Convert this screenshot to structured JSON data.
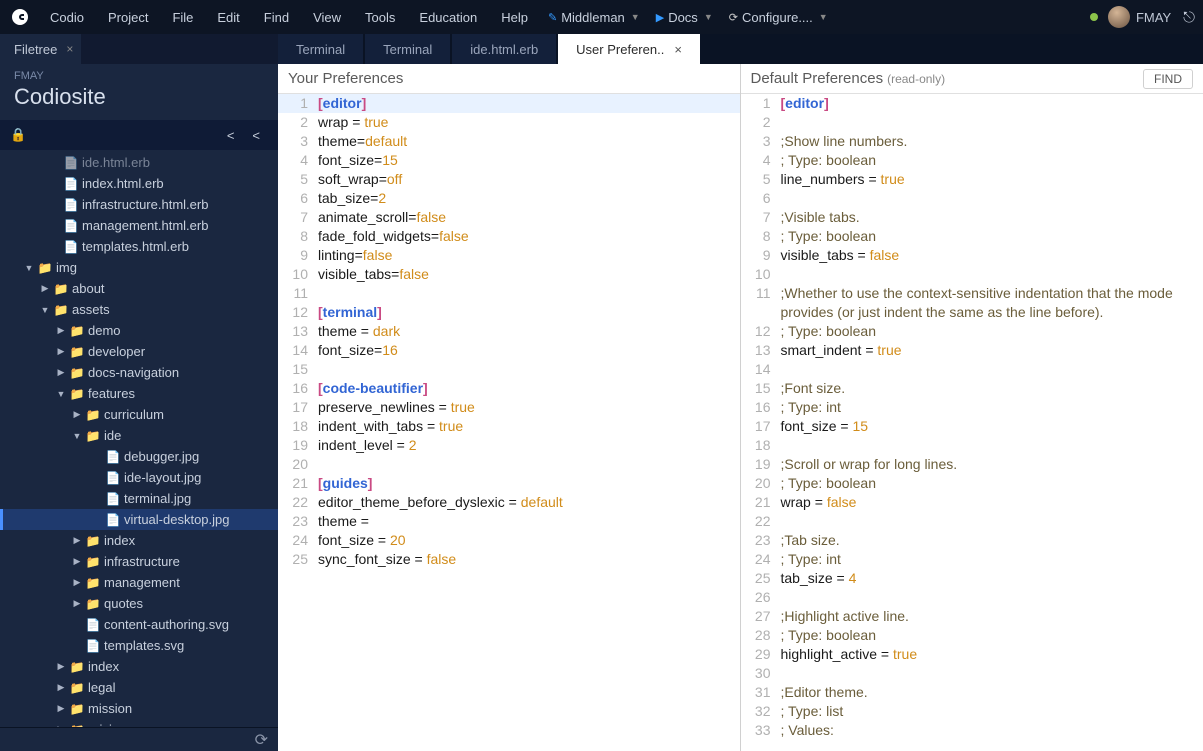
{
  "menubar": [
    "Codio",
    "Project",
    "File",
    "Edit",
    "Find",
    "View",
    "Tools",
    "Education",
    "Help"
  ],
  "configs": [
    {
      "icon": "✎",
      "label": "Middleman",
      "color": "#3399ff",
      "caret": true
    },
    {
      "icon": "▶",
      "label": "Docs",
      "color": "#3399ff",
      "caret": true
    },
    {
      "icon": "⟳",
      "label": "Configure....",
      "color": "#cccccc",
      "caret": true
    }
  ],
  "user": "FMAY",
  "sidepanel": {
    "tab": "Filetree",
    "org": "FMAY",
    "project": "Codiosite"
  },
  "tree": [
    {
      "d": 48,
      "t": "f",
      "n": "ide.html.erb",
      "dim": true
    },
    {
      "d": 48,
      "t": "f",
      "n": "index.html.erb"
    },
    {
      "d": 48,
      "t": "f",
      "n": "infrastructure.html.erb"
    },
    {
      "d": 48,
      "t": "f",
      "n": "management.html.erb"
    },
    {
      "d": 48,
      "t": "f",
      "n": "templates.html.erb"
    },
    {
      "d": 22,
      "t": "d",
      "n": "img",
      "open": true
    },
    {
      "d": 38,
      "t": "d",
      "n": "about",
      "closed": true
    },
    {
      "d": 38,
      "t": "d",
      "n": "assets",
      "open": true
    },
    {
      "d": 54,
      "t": "d",
      "n": "demo",
      "closed": true
    },
    {
      "d": 54,
      "t": "d",
      "n": "developer",
      "closed": true
    },
    {
      "d": 54,
      "t": "d",
      "n": "docs-navigation",
      "closed": true
    },
    {
      "d": 54,
      "t": "d",
      "n": "features",
      "open": true
    },
    {
      "d": 70,
      "t": "d",
      "n": "curriculum",
      "closed": true
    },
    {
      "d": 70,
      "t": "d",
      "n": "ide",
      "open": true
    },
    {
      "d": 90,
      "t": "f",
      "n": "debugger.jpg"
    },
    {
      "d": 90,
      "t": "f",
      "n": "ide-layout.jpg"
    },
    {
      "d": 90,
      "t": "f",
      "n": "terminal.jpg"
    },
    {
      "d": 90,
      "t": "f",
      "n": "virtual-desktop.jpg",
      "sel": true
    },
    {
      "d": 70,
      "t": "d",
      "n": "index",
      "closed": true
    },
    {
      "d": 70,
      "t": "d",
      "n": "infrastructure",
      "closed": true
    },
    {
      "d": 70,
      "t": "d",
      "n": "management",
      "closed": true
    },
    {
      "d": 70,
      "t": "d",
      "n": "quotes",
      "closed": true
    },
    {
      "d": 70,
      "t": "f",
      "n": "content-authoring.svg"
    },
    {
      "d": 70,
      "t": "f",
      "n": "templates.svg"
    },
    {
      "d": 54,
      "t": "d",
      "n": "index",
      "closed": true
    },
    {
      "d": 54,
      "t": "d",
      "n": "legal",
      "closed": true
    },
    {
      "d": 54,
      "t": "d",
      "n": "mission",
      "closed": true
    },
    {
      "d": 54,
      "t": "d",
      "n": "pricing",
      "closed": true
    }
  ],
  "tabs": [
    {
      "label": "Terminal"
    },
    {
      "label": "Terminal"
    },
    {
      "label": "ide.html.erb"
    },
    {
      "label": "User Preferen..",
      "active": true,
      "close": true
    }
  ],
  "left": {
    "title": "Your Preferences",
    "lines": [
      [
        {
          "c": "br",
          "t": "["
        },
        {
          "c": "sec",
          "t": "editor"
        },
        {
          "c": "br",
          "t": "]"
        }
      ],
      [
        {
          "c": "key",
          "t": "wrap"
        },
        {
          "c": "op",
          "t": " = "
        },
        {
          "c": "val",
          "t": "true"
        }
      ],
      [
        {
          "c": "key",
          "t": "theme"
        },
        {
          "c": "op",
          "t": "="
        },
        {
          "c": "val",
          "t": "default"
        }
      ],
      [
        {
          "c": "key",
          "t": "font_size"
        },
        {
          "c": "op",
          "t": "="
        },
        {
          "c": "val",
          "t": "15"
        }
      ],
      [
        {
          "c": "key",
          "t": "soft_wrap"
        },
        {
          "c": "op",
          "t": "="
        },
        {
          "c": "val",
          "t": "off"
        }
      ],
      [
        {
          "c": "key",
          "t": "tab_size"
        },
        {
          "c": "op",
          "t": "="
        },
        {
          "c": "val",
          "t": "2"
        }
      ],
      [
        {
          "c": "key",
          "t": "animate_scroll"
        },
        {
          "c": "op",
          "t": "="
        },
        {
          "c": "val",
          "t": "false"
        }
      ],
      [
        {
          "c": "key",
          "t": "fade_fold_widgets"
        },
        {
          "c": "op",
          "t": "="
        },
        {
          "c": "val",
          "t": "false"
        }
      ],
      [
        {
          "c": "key",
          "t": "linting"
        },
        {
          "c": "op",
          "t": "="
        },
        {
          "c": "val",
          "t": "false"
        }
      ],
      [
        {
          "c": "key",
          "t": "visible_tabs"
        },
        {
          "c": "op",
          "t": "="
        },
        {
          "c": "val",
          "t": "false"
        }
      ],
      [],
      [
        {
          "c": "br",
          "t": "["
        },
        {
          "c": "sec",
          "t": "terminal"
        },
        {
          "c": "br",
          "t": "]"
        }
      ],
      [
        {
          "c": "key",
          "t": "theme"
        },
        {
          "c": "op",
          "t": " = "
        },
        {
          "c": "val",
          "t": "dark"
        }
      ],
      [
        {
          "c": "key",
          "t": "font_size"
        },
        {
          "c": "op",
          "t": "="
        },
        {
          "c": "val",
          "t": "16"
        }
      ],
      [],
      [
        {
          "c": "br",
          "t": "["
        },
        {
          "c": "sec",
          "t": "code-beautifier"
        },
        {
          "c": "br",
          "t": "]"
        }
      ],
      [
        {
          "c": "key",
          "t": "preserve_newlines"
        },
        {
          "c": "op",
          "t": " = "
        },
        {
          "c": "val",
          "t": "true"
        }
      ],
      [
        {
          "c": "key",
          "t": "indent_with_tabs"
        },
        {
          "c": "op",
          "t": " = "
        },
        {
          "c": "val",
          "t": "true"
        }
      ],
      [
        {
          "c": "key",
          "t": "indent_level"
        },
        {
          "c": "op",
          "t": " = "
        },
        {
          "c": "val",
          "t": "2"
        }
      ],
      [],
      [
        {
          "c": "br",
          "t": "["
        },
        {
          "c": "sec",
          "t": "guides"
        },
        {
          "c": "br",
          "t": "]"
        }
      ],
      [
        {
          "c": "key",
          "t": "editor_theme_before_dyslexic"
        },
        {
          "c": "op",
          "t": " = "
        },
        {
          "c": "val",
          "t": "default"
        }
      ],
      [
        {
          "c": "key",
          "t": "theme"
        },
        {
          "c": "op",
          "t": " = "
        }
      ],
      [
        {
          "c": "key",
          "t": "font_size"
        },
        {
          "c": "op",
          "t": " = "
        },
        {
          "c": "val",
          "t": "20"
        }
      ],
      [
        {
          "c": "key",
          "t": "sync_font_size"
        },
        {
          "c": "op",
          "t": " = "
        },
        {
          "c": "val",
          "t": "false"
        }
      ]
    ]
  },
  "right": {
    "title": "Default Preferences",
    "readonly": "(read-only)",
    "find": "FIND",
    "lines": [
      {
        "n": 1,
        "tokens": [
          {
            "c": "br",
            "t": "["
          },
          {
            "c": "sec",
            "t": "editor"
          },
          {
            "c": "br",
            "t": "]"
          }
        ]
      },
      {
        "n": 2,
        "tokens": []
      },
      {
        "n": 3,
        "tokens": [
          {
            "c": "com",
            "t": ";Show line numbers."
          }
        ]
      },
      {
        "n": 4,
        "tokens": [
          {
            "c": "com",
            "t": "; Type: boolean"
          }
        ]
      },
      {
        "n": 5,
        "tokens": [
          {
            "c": "key",
            "t": "line_numbers"
          },
          {
            "c": "op",
            "t": " = "
          },
          {
            "c": "val",
            "t": "true"
          }
        ]
      },
      {
        "n": 6,
        "tokens": []
      },
      {
        "n": 7,
        "tokens": [
          {
            "c": "com",
            "t": ";Visible tabs."
          }
        ]
      },
      {
        "n": 8,
        "tokens": [
          {
            "c": "com",
            "t": "; Type: boolean"
          }
        ]
      },
      {
        "n": 9,
        "tokens": [
          {
            "c": "key",
            "t": "visible_tabs"
          },
          {
            "c": "op",
            "t": " = "
          },
          {
            "c": "val",
            "t": "false"
          }
        ]
      },
      {
        "n": 10,
        "tokens": []
      },
      {
        "n": 11,
        "tokens": [
          {
            "c": "com",
            "t": ";Whether to use the context-sensitive indentation that the mode provides (or just indent the same as the line before)."
          }
        ]
      },
      {
        "n": 12,
        "tokens": [
          {
            "c": "com",
            "t": "; Type: boolean"
          }
        ]
      },
      {
        "n": 13,
        "tokens": [
          {
            "c": "key",
            "t": "smart_indent"
          },
          {
            "c": "op",
            "t": " = "
          },
          {
            "c": "val",
            "t": "true"
          }
        ]
      },
      {
        "n": 14,
        "tokens": []
      },
      {
        "n": 15,
        "tokens": [
          {
            "c": "com",
            "t": ";Font size."
          }
        ]
      },
      {
        "n": 16,
        "tokens": [
          {
            "c": "com",
            "t": "; Type: int"
          }
        ]
      },
      {
        "n": 17,
        "tokens": [
          {
            "c": "key",
            "t": "font_size"
          },
          {
            "c": "op",
            "t": " = "
          },
          {
            "c": "val",
            "t": "15"
          }
        ]
      },
      {
        "n": 18,
        "tokens": []
      },
      {
        "n": 19,
        "tokens": [
          {
            "c": "com",
            "t": ";Scroll or wrap for long lines."
          }
        ]
      },
      {
        "n": 20,
        "tokens": [
          {
            "c": "com",
            "t": "; Type: boolean"
          }
        ]
      },
      {
        "n": 21,
        "tokens": [
          {
            "c": "key",
            "t": "wrap"
          },
          {
            "c": "op",
            "t": " = "
          },
          {
            "c": "val",
            "t": "false"
          }
        ]
      },
      {
        "n": 22,
        "tokens": []
      },
      {
        "n": 23,
        "tokens": [
          {
            "c": "com",
            "t": ";Tab size."
          }
        ]
      },
      {
        "n": 24,
        "tokens": [
          {
            "c": "com",
            "t": "; Type: int"
          }
        ]
      },
      {
        "n": 25,
        "tokens": [
          {
            "c": "key",
            "t": "tab_size"
          },
          {
            "c": "op",
            "t": " = "
          },
          {
            "c": "val",
            "t": "4"
          }
        ]
      },
      {
        "n": 26,
        "tokens": []
      },
      {
        "n": 27,
        "tokens": [
          {
            "c": "com",
            "t": ";Highlight active line."
          }
        ]
      },
      {
        "n": 28,
        "tokens": [
          {
            "c": "com",
            "t": "; Type: boolean"
          }
        ]
      },
      {
        "n": 29,
        "tokens": [
          {
            "c": "key",
            "t": "highlight_active"
          },
          {
            "c": "op",
            "t": " = "
          },
          {
            "c": "val",
            "t": "true"
          }
        ]
      },
      {
        "n": 30,
        "tokens": []
      },
      {
        "n": 31,
        "tokens": [
          {
            "c": "com",
            "t": ";Editor theme."
          }
        ]
      },
      {
        "n": 32,
        "tokens": [
          {
            "c": "com",
            "t": "; Type: list"
          }
        ]
      },
      {
        "n": 33,
        "tokens": [
          {
            "c": "com",
            "t": "; Values:"
          }
        ]
      }
    ]
  }
}
